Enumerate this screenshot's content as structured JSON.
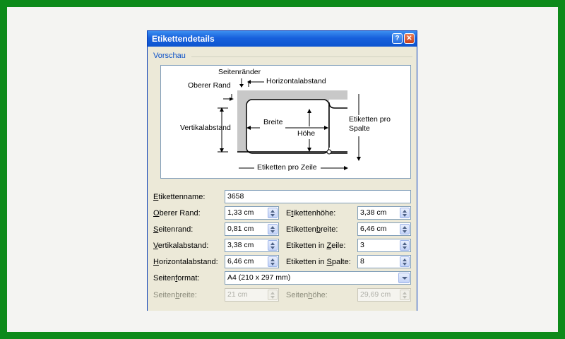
{
  "dialog": {
    "title": "Etikettendetails",
    "help_icon": "?",
    "close_icon": "✕",
    "group_title": "Vorschau"
  },
  "preview": {
    "seitenraender": "Seitenränder",
    "oberer_rand": "Oberer Rand",
    "horizontalabstand": "Horizontalabstand",
    "vertikalabstand": "Vertikalabstand",
    "breite": "Breite",
    "hoehe": "Höhe",
    "etiketten_pro_spalte_1": "Etiketten pro",
    "etiketten_pro_spalte_2": "Spalte",
    "etiketten_pro_zeile": "Etiketten pro Zeile"
  },
  "form": {
    "name_label_u": "E",
    "name_label_rest": "tikettenname:",
    "name_value": "3658",
    "rows": [
      {
        "left_label_u": "O",
        "left_label_rest": "berer Rand:",
        "left_value": "1,33 cm",
        "right_label_pre": "E",
        "right_label_u": "t",
        "right_label_rest": "ikettenhöhe:",
        "right_value": "3,38 cm"
      },
      {
        "left_label_u": "S",
        "left_label_rest": "eitenrand:",
        "left_value": "0,81 cm",
        "right_label_pre": "Etiketten",
        "right_label_u": "b",
        "right_label_rest": "reite:",
        "right_value": "6,46 cm"
      },
      {
        "left_label_u": "V",
        "left_label_rest": "ertikalabstand:",
        "left_value": "3,38 cm",
        "right_label_pre": "Etiketten in ",
        "right_label_u": "Z",
        "right_label_rest": "eile:",
        "right_value": "3"
      },
      {
        "left_label_u": "H",
        "left_label_rest": "orizontalabstand:",
        "left_value": "6,46 cm",
        "right_label_pre": "Etiketten in ",
        "right_label_u": "S",
        "right_label_rest": "palte:",
        "right_value": "8"
      }
    ],
    "format_label_pre": "Seiten",
    "format_label_u": "f",
    "format_label_rest": "ormat:",
    "format_value": "A4 (210 x 297 mm)",
    "width_label_pre": "Seiten",
    "width_label_u": "b",
    "width_label_rest": "reite:",
    "width_value": "21 cm",
    "height_label_pre": "Seiten",
    "height_label_u": "h",
    "height_label_rest": "öhe:",
    "height_value": "29,69 cm"
  },
  "colors": {
    "frame": "#0d8a1a",
    "titlebar": "#1760dc",
    "dialog_bg": "#ece9d8",
    "accent_text": "#0a50c8"
  }
}
